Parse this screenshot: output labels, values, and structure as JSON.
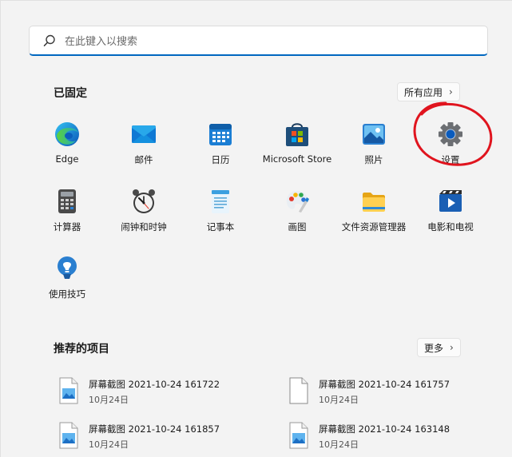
{
  "search": {
    "placeholder": "在此键入以搜索"
  },
  "pinned": {
    "title": "已固定",
    "all_apps_label": "所有应用",
    "apps": [
      {
        "label": "Edge",
        "icon": "edge-icon"
      },
      {
        "label": "邮件",
        "icon": "mail-icon"
      },
      {
        "label": "日历",
        "icon": "calendar-icon"
      },
      {
        "label": "Microsoft Store",
        "icon": "store-icon"
      },
      {
        "label": "照片",
        "icon": "photos-icon"
      },
      {
        "label": "设置",
        "icon": "gear-icon"
      },
      {
        "label": "计算器",
        "icon": "calculator-icon"
      },
      {
        "label": "闹钟和时钟",
        "icon": "clock-icon"
      },
      {
        "label": "记事本",
        "icon": "notepad-icon"
      },
      {
        "label": "画图",
        "icon": "paint-icon"
      },
      {
        "label": "文件资源管理器",
        "icon": "folder-icon"
      },
      {
        "label": "电影和电视",
        "icon": "movies-icon"
      },
      {
        "label": "使用技巧",
        "icon": "tips-icon"
      }
    ]
  },
  "recommended": {
    "title": "推荐的项目",
    "more_label": "更多",
    "items": [
      {
        "name": "屏幕截图 2021-10-24 161722",
        "date": "10月24日",
        "icon": "image-file-icon"
      },
      {
        "name": "屏幕截图 2021-10-24 161757",
        "date": "10月24日",
        "icon": "blank-file-icon"
      },
      {
        "name": "屏幕截图 2021-10-24 161857",
        "date": "10月24日",
        "icon": "image-file-icon"
      },
      {
        "name": "屏幕截图 2021-10-24 163148",
        "date": "10月24日",
        "icon": "image-file-icon"
      }
    ]
  },
  "colors": {
    "accent": "#0067c0",
    "annotation": "#e0141e"
  }
}
